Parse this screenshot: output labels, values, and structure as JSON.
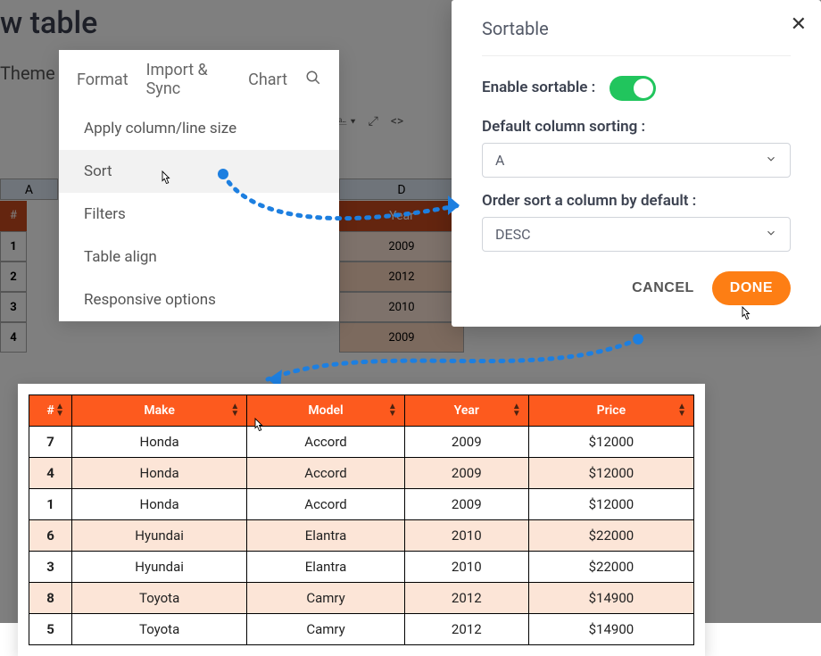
{
  "page_title": "w table",
  "top": {
    "theme": "Theme"
  },
  "menu": {
    "tabs": {
      "format": "Format",
      "import": "Import & Sync",
      "chart": "Chart"
    },
    "items": {
      "apply": "Apply column/line size",
      "sort": "Sort",
      "filters": "Filters",
      "table_align": "Table align",
      "responsive": "Responsive options"
    }
  },
  "modal": {
    "title": "Sortable",
    "enable_label": "Enable sortable :",
    "default_col_label": "Default column sorting :",
    "default_col_value": "A",
    "order_label": "Order sort a column by default :",
    "order_value": "DESC",
    "cancel": "CANCEL",
    "done": "DONE"
  },
  "bg_grid": {
    "col_a": "A",
    "col_d": "D",
    "hash": "#",
    "year_header": "Year",
    "rows": [
      {
        "n": "1",
        "year": "2009"
      },
      {
        "n": "2",
        "year": "2012"
      },
      {
        "n": "3",
        "year": "2010"
      },
      {
        "n": "4",
        "year": "2009"
      }
    ]
  },
  "result_table": {
    "headers": {
      "num": "#",
      "make": "Make",
      "model": "Model",
      "year": "Year",
      "price": "Price"
    },
    "rows": [
      {
        "num": "7",
        "make": "Honda",
        "model": "Accord",
        "year": "2009",
        "price": "$12000"
      },
      {
        "num": "4",
        "make": "Honda",
        "model": "Accord",
        "year": "2009",
        "price": "$12000"
      },
      {
        "num": "1",
        "make": "Honda",
        "model": "Accord",
        "year": "2009",
        "price": "$12000"
      },
      {
        "num": "6",
        "make": "Hyundai",
        "model": "Elantra",
        "year": "2010",
        "price": "$22000"
      },
      {
        "num": "3",
        "make": "Hyundai",
        "model": "Elantra",
        "year": "2010",
        "price": "$22000"
      },
      {
        "num": "8",
        "make": "Toyota",
        "model": "Camry",
        "year": "2012",
        "price": "$14900"
      },
      {
        "num": "5",
        "make": "Toyota",
        "model": "Camry",
        "year": "2012",
        "price": "$14900"
      }
    ]
  }
}
